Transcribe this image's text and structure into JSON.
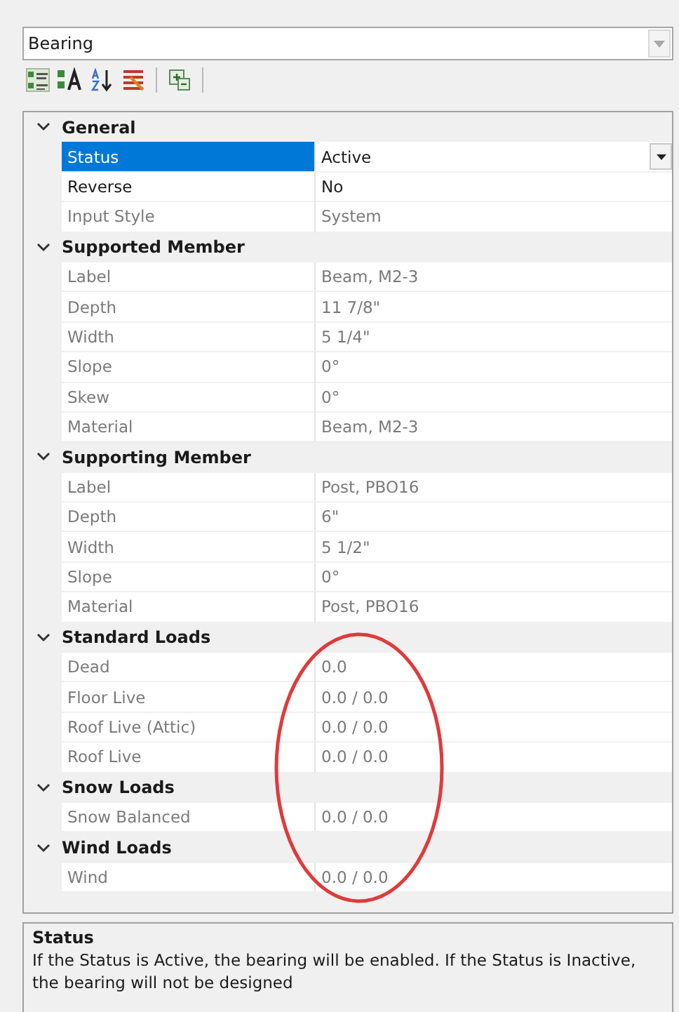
{
  "object_selector": {
    "value": "Bearing"
  },
  "categories": [
    {
      "name": "General",
      "expanded": true,
      "properties": [
        {
          "label": "Status",
          "value": "Active",
          "kind": "dropdown",
          "selected": true,
          "disabled": false
        },
        {
          "label": "Reverse",
          "value": "No",
          "kind": "text",
          "selected": false,
          "disabled": false
        },
        {
          "label": "Input Style",
          "value": "System",
          "kind": "text",
          "selected": false,
          "disabled": true
        }
      ]
    },
    {
      "name": "Supported Member",
      "expanded": true,
      "properties": [
        {
          "label": "Label",
          "value": "Beam, M2-3",
          "kind": "text",
          "selected": false,
          "disabled": true
        },
        {
          "label": "Depth",
          "value": "11 7/8\"",
          "kind": "text",
          "selected": false,
          "disabled": true
        },
        {
          "label": "Width",
          "value": "5 1/4\"",
          "kind": "text",
          "selected": false,
          "disabled": true
        },
        {
          "label": "Slope",
          "value": "0°",
          "kind": "text",
          "selected": false,
          "disabled": true
        },
        {
          "label": "Skew",
          "value": "0°",
          "kind": "text",
          "selected": false,
          "disabled": true
        },
        {
          "label": "Material",
          "value": "Beam, M2-3",
          "kind": "text",
          "selected": false,
          "disabled": true
        }
      ]
    },
    {
      "name": "Supporting Member",
      "expanded": true,
      "properties": [
        {
          "label": "Label",
          "value": "Post, PBO16",
          "kind": "text",
          "selected": false,
          "disabled": true
        },
        {
          "label": "Depth",
          "value": "6\"",
          "kind": "text",
          "selected": false,
          "disabled": true
        },
        {
          "label": "Width",
          "value": "5 1/2\"",
          "kind": "text",
          "selected": false,
          "disabled": true
        },
        {
          "label": "Slope",
          "value": "0°",
          "kind": "text",
          "selected": false,
          "disabled": true
        },
        {
          "label": "Material",
          "value": "Post, PBO16",
          "kind": "text",
          "selected": false,
          "disabled": true
        }
      ]
    },
    {
      "name": "Standard Loads",
      "expanded": true,
      "properties": [
        {
          "label": "Dead",
          "value": "0.0",
          "kind": "text",
          "selected": false,
          "disabled": true
        },
        {
          "label": "Floor Live",
          "value": "0.0 / 0.0",
          "kind": "text",
          "selected": false,
          "disabled": true
        },
        {
          "label": "Roof Live (Attic)",
          "value": "0.0 / 0.0",
          "kind": "text",
          "selected": false,
          "disabled": true
        },
        {
          "label": "Roof Live",
          "value": "0.0 / 0.0",
          "kind": "text",
          "selected": false,
          "disabled": true
        }
      ]
    },
    {
      "name": "Snow Loads",
      "expanded": true,
      "properties": [
        {
          "label": "Snow Balanced",
          "value": "0.0 / 0.0",
          "kind": "text",
          "selected": false,
          "disabled": true
        }
      ]
    },
    {
      "name": "Wind Loads",
      "expanded": true,
      "properties": [
        {
          "label": "Wind",
          "value": "0.0 / 0.0",
          "kind": "text",
          "selected": false,
          "disabled": true
        }
      ]
    }
  ],
  "description": {
    "title": "Status",
    "text": "If the Status is Active, the bearing will be enabled. If the Status is Inactive, the bearing will not be designed"
  }
}
